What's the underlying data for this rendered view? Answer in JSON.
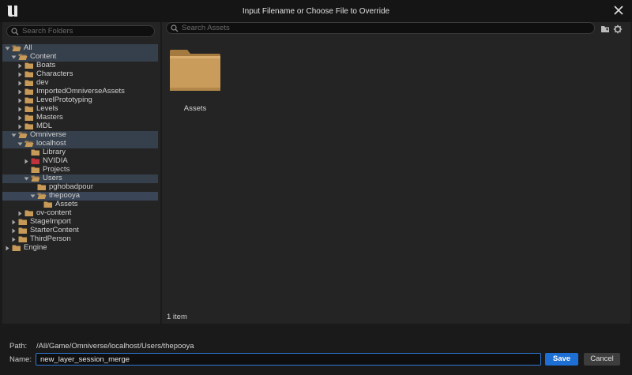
{
  "window": {
    "title": "Input Filename or Choose File to Override",
    "logo_icon": "unreal-engine-logo",
    "close_icon": "close-icon"
  },
  "folders": {
    "search_placeholder": "Search Folders",
    "tree": [
      {
        "label": "All",
        "expanded": true,
        "highlight": "hl"
      },
      {
        "label": "Content",
        "expanded": true,
        "highlight": "hl"
      },
      {
        "label": "Boats",
        "expanded": false
      },
      {
        "label": "Characters",
        "expanded": false
      },
      {
        "label": "dev",
        "expanded": false
      },
      {
        "label": "ImportedOmniverseAssets",
        "expanded": false
      },
      {
        "label": "LevelPrototyping",
        "expanded": false
      },
      {
        "label": "Levels",
        "expanded": false
      },
      {
        "label": "Masters",
        "expanded": false
      },
      {
        "label": "MDL",
        "expanded": false
      },
      {
        "label": "Omniverse",
        "expanded": true,
        "highlight": "hl"
      },
      {
        "label": "localhost",
        "expanded": true,
        "highlight": "hl"
      },
      {
        "label": "Library",
        "expanded": null
      },
      {
        "label": "NVIDIA",
        "expanded": false,
        "folder_color": "#c0323c"
      },
      {
        "label": "Projects",
        "expanded": null
      },
      {
        "label": "Users",
        "expanded": true,
        "highlight": "hl"
      },
      {
        "label": "pghobadpour",
        "expanded": null
      },
      {
        "label": "thepooya",
        "expanded": true,
        "highlight": "sel"
      },
      {
        "label": "Assets",
        "expanded": null
      },
      {
        "label": "ov-content",
        "expanded": false
      },
      {
        "label": "StageImport",
        "expanded": false
      },
      {
        "label": "StarterContent",
        "expanded": false
      },
      {
        "label": "ThirdPerson",
        "expanded": false
      },
      {
        "label": "Engine",
        "expanded": false
      }
    ]
  },
  "assets": {
    "search_placeholder": "Search Assets",
    "toolbar": {
      "folder_icon": "folder-icon",
      "settings_icon": "gear-icon"
    },
    "items": [
      {
        "label": "Assets",
        "icon": "folder-icon"
      }
    ],
    "count_text": "1 item"
  },
  "footer": {
    "path_label": "Path:",
    "path_value": "/All/Game/Omniverse/localhost/Users/thepooya",
    "name_label": "Name:",
    "name_value": "new_layer_session_merge",
    "save_label": "Save",
    "cancel_label": "Cancel"
  },
  "colors": {
    "folder": "#c89a58",
    "accent": "#1e6fd3",
    "selection": "#3a4657"
  }
}
